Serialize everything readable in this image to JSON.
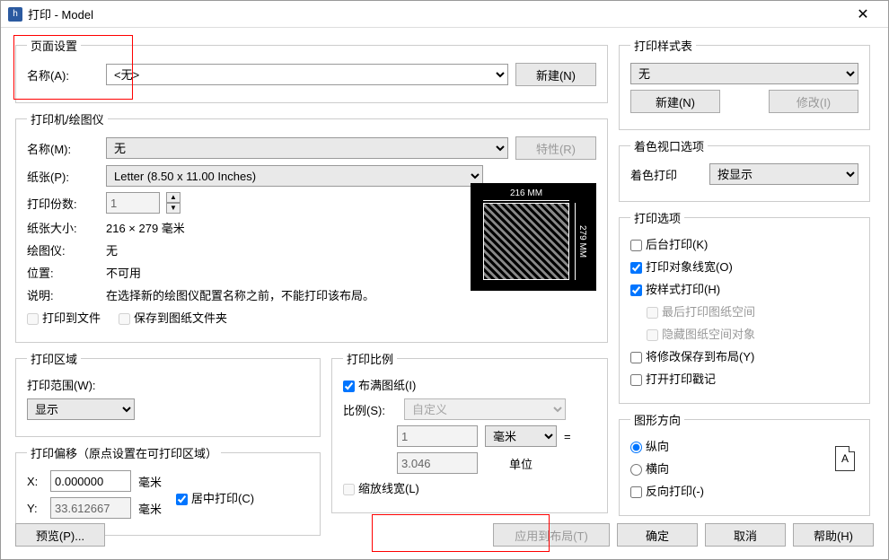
{
  "window": {
    "title": "打印 - Model"
  },
  "pageSetup": {
    "legend": "页面设置",
    "nameLabel": "名称(A):",
    "nameValue": "<无>",
    "newBtn": "新建(N)"
  },
  "printer": {
    "legend": "打印机/绘图仪",
    "nameLabel": "名称(M):",
    "nameValue": "无",
    "propsBtn": "特性(R)",
    "paperLabel": "纸张(P):",
    "paperValue": "Letter (8.50 x 11.00 Inches)",
    "copiesLabel": "打印份数:",
    "copiesValue": "1",
    "sizeLabel": "纸张大小:",
    "sizeValue": "216 × 279  毫米",
    "plotterLabel": "绘图仪:",
    "plotterValue": "无",
    "locationLabel": "位置:",
    "locationValue": "不可用",
    "descLabel": "说明:",
    "descValue": "在选择新的绘图仪配置名称之前，不能打印该布局。",
    "printToFile": "打印到文件",
    "saveToFolder": "保存到图纸文件夹",
    "previewDimW": "216 MM",
    "previewDimH": "279 MM"
  },
  "plotArea": {
    "legend": "打印区域",
    "rangeLabel": "打印范围(W):",
    "rangeValue": "显示"
  },
  "plotOffset": {
    "legend": "打印偏移（原点设置在可打印区域）",
    "xLabel": "X:",
    "xValue": "0.000000",
    "xUnit": "毫米",
    "yLabel": "Y:",
    "yValue": "33.612667",
    "yUnit": "毫米",
    "center": "居中打印(C)"
  },
  "plotScale": {
    "legend": "打印比例",
    "fitPaper": "布满图纸(I)",
    "scaleLabel": "比例(S):",
    "scaleValue": "自定义",
    "unitValue": "毫米",
    "num1": "1",
    "num2": "3.046",
    "eq": "=",
    "unitLabel": "单位",
    "scaleLineweights": "缩放线宽(L)"
  },
  "styleTable": {
    "legend": "打印样式表",
    "value": "无",
    "newBtn": "新建(N)",
    "editBtn": "修改(I)"
  },
  "shaded": {
    "legend": "着色视口选项",
    "shadeLabel": "着色打印",
    "shadeValue": "按显示"
  },
  "options": {
    "legend": "打印选项",
    "background": "后台打印(K)",
    "lineweights": "打印对象线宽(O)",
    "styles": "按样式打印(H)",
    "lastPaper": "最后打印图纸空间",
    "hidePaper": "隐藏图纸空间对象",
    "saveLayout": "将修改保存到布局(Y)",
    "stamp": "打开打印戳记"
  },
  "orientation": {
    "legend": "图形方向",
    "portrait": "纵向",
    "landscape": "横向",
    "reverse": "反向打印(-)",
    "iconLetter": "A"
  },
  "buttons": {
    "preview": "预览(P)...",
    "apply": "应用到布局(T)",
    "ok": "确定",
    "cancel": "取消",
    "help": "帮助(H)"
  }
}
